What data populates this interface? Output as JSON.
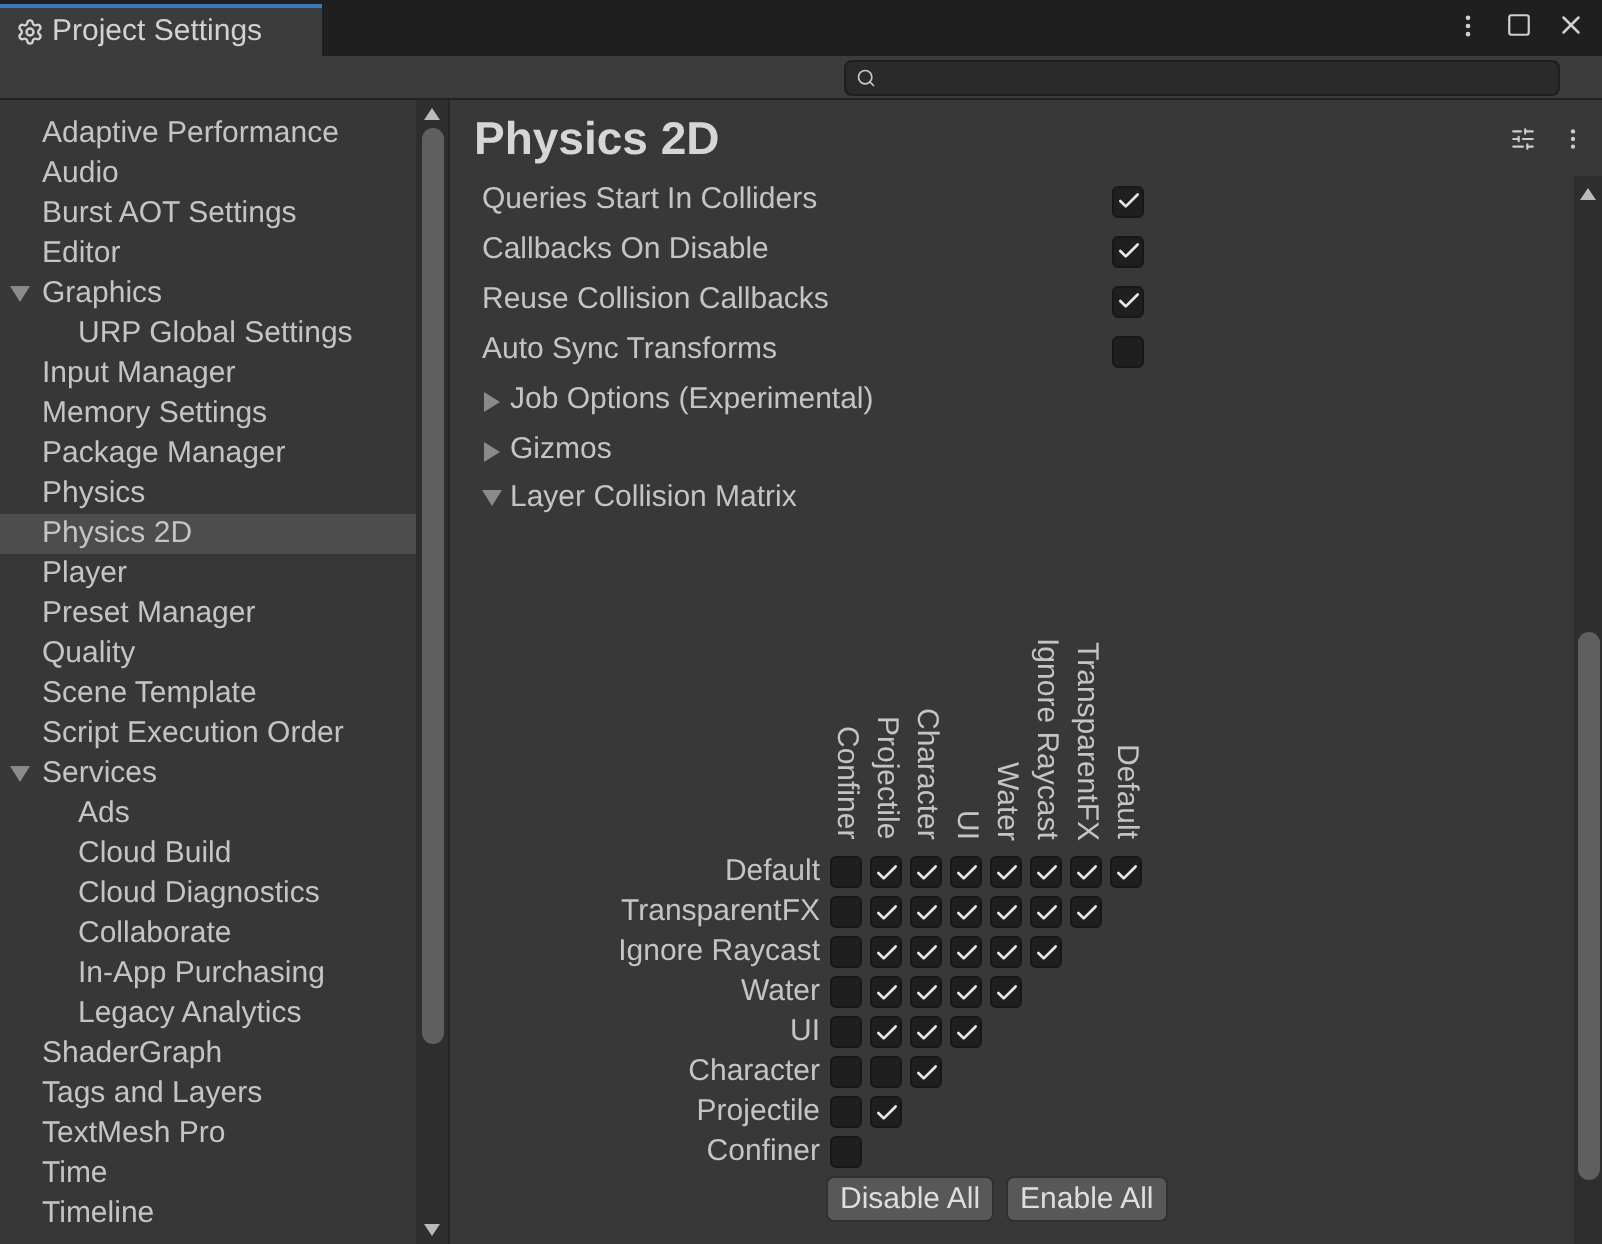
{
  "window": {
    "title": "Project Settings"
  },
  "sidebar": {
    "items": [
      {
        "label": "Adaptive Performance",
        "selected": false
      },
      {
        "label": "Audio",
        "selected": false
      },
      {
        "label": "Burst AOT Settings",
        "selected": false
      },
      {
        "label": "Editor",
        "selected": false
      },
      {
        "label": "Graphics",
        "selected": false,
        "expanded": true,
        "children": [
          {
            "label": "URP Global Settings",
            "selected": false
          }
        ]
      },
      {
        "label": "Input Manager",
        "selected": false
      },
      {
        "label": "Memory Settings",
        "selected": false
      },
      {
        "label": "Package Manager",
        "selected": false
      },
      {
        "label": "Physics",
        "selected": false
      },
      {
        "label": "Physics 2D",
        "selected": true
      },
      {
        "label": "Player",
        "selected": false
      },
      {
        "label": "Preset Manager",
        "selected": false
      },
      {
        "label": "Quality",
        "selected": false
      },
      {
        "label": "Scene Template",
        "selected": false
      },
      {
        "label": "Script Execution Order",
        "selected": false
      },
      {
        "label": "Services",
        "selected": false,
        "expanded": true,
        "children": [
          {
            "label": "Ads",
            "selected": false
          },
          {
            "label": "Cloud Build",
            "selected": false
          },
          {
            "label": "Cloud Diagnostics",
            "selected": false
          },
          {
            "label": "Collaborate",
            "selected": false
          },
          {
            "label": "In-App Purchasing",
            "selected": false
          },
          {
            "label": "Legacy Analytics",
            "selected": false
          }
        ]
      },
      {
        "label": "ShaderGraph",
        "selected": false
      },
      {
        "label": "Tags and Layers",
        "selected": false
      },
      {
        "label": "TextMesh Pro",
        "selected": false
      },
      {
        "label": "Time",
        "selected": false
      },
      {
        "label": "Timeline",
        "selected": false
      }
    ]
  },
  "panel": {
    "title": "Physics 2D",
    "settings": [
      {
        "label": "Queries Start In Colliders",
        "checked": true
      },
      {
        "label": "Callbacks On Disable",
        "checked": true
      },
      {
        "label": "Reuse Collision Callbacks",
        "checked": true
      },
      {
        "label": "Auto Sync Transforms",
        "checked": false
      }
    ],
    "sections": [
      {
        "label": "Job Options (Experimental)",
        "expanded": false
      },
      {
        "label": "Gizmos",
        "expanded": false
      },
      {
        "label": "Layer Collision Matrix",
        "expanded": true
      }
    ],
    "matrix": {
      "columns": [
        "Confiner",
        "Projectile",
        "Character",
        "UI",
        "Water",
        "Ignore Raycast",
        "TransparentFX",
        "Default"
      ],
      "rows": [
        {
          "label": "Default",
          "cells": [
            {
              "checked": false
            },
            {
              "checked": true
            },
            {
              "checked": true
            },
            {
              "checked": true
            },
            {
              "checked": true
            },
            {
              "checked": true
            },
            {
              "checked": true
            },
            {
              "checked": true
            }
          ]
        },
        {
          "label": "TransparentFX",
          "cells": [
            {
              "checked": false
            },
            {
              "checked": true
            },
            {
              "checked": true
            },
            {
              "checked": true
            },
            {
              "checked": true
            },
            {
              "checked": true
            },
            {
              "checked": true
            }
          ]
        },
        {
          "label": "Ignore Raycast",
          "cells": [
            {
              "checked": false
            },
            {
              "checked": true
            },
            {
              "checked": true
            },
            {
              "checked": true
            },
            {
              "checked": true
            },
            {
              "checked": true
            }
          ]
        },
        {
          "label": "Water",
          "cells": [
            {
              "checked": false
            },
            {
              "checked": true
            },
            {
              "checked": true
            },
            {
              "checked": true
            },
            {
              "checked": true
            }
          ]
        },
        {
          "label": "UI",
          "cells": [
            {
              "checked": false
            },
            {
              "checked": true
            },
            {
              "checked": true
            },
            {
              "checked": true
            }
          ]
        },
        {
          "label": "Character",
          "cells": [
            {
              "checked": false
            },
            {
              "checked": false
            },
            {
              "checked": true
            }
          ]
        },
        {
          "label": "Projectile",
          "cells": [
            {
              "checked": false
            },
            {
              "checked": true
            }
          ]
        },
        {
          "label": "Confiner",
          "cells": [
            {
              "checked": false
            }
          ]
        }
      ]
    },
    "buttons": [
      "Disable All",
      "Enable All"
    ]
  }
}
